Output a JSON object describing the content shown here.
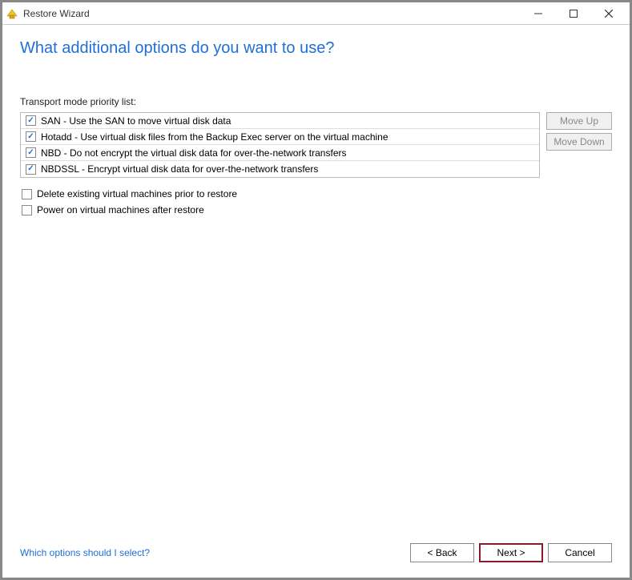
{
  "window": {
    "title": "Restore Wizard"
  },
  "heading": "What additional options do you want to use?",
  "transport": {
    "label": "Transport mode priority list:",
    "items": [
      {
        "checked": true,
        "label": "SAN - Use the SAN to move virtual disk data"
      },
      {
        "checked": true,
        "label": "Hotadd - Use virtual disk files from the Backup Exec server on the virtual machine"
      },
      {
        "checked": true,
        "label": "NBD - Do not encrypt the virtual disk data for over-the-network transfers"
      },
      {
        "checked": true,
        "label": "NBDSSL - Encrypt virtual disk data for over-the-network transfers"
      }
    ],
    "move_up": "Move Up",
    "move_down": "Move Down"
  },
  "options": [
    {
      "checked": false,
      "label": "Delete existing virtual machines prior to restore"
    },
    {
      "checked": false,
      "label": "Power on virtual machines after restore"
    }
  ],
  "help_link": "Which options should I select?",
  "footer": {
    "back": "< Back",
    "next": "Next >",
    "cancel": "Cancel"
  }
}
